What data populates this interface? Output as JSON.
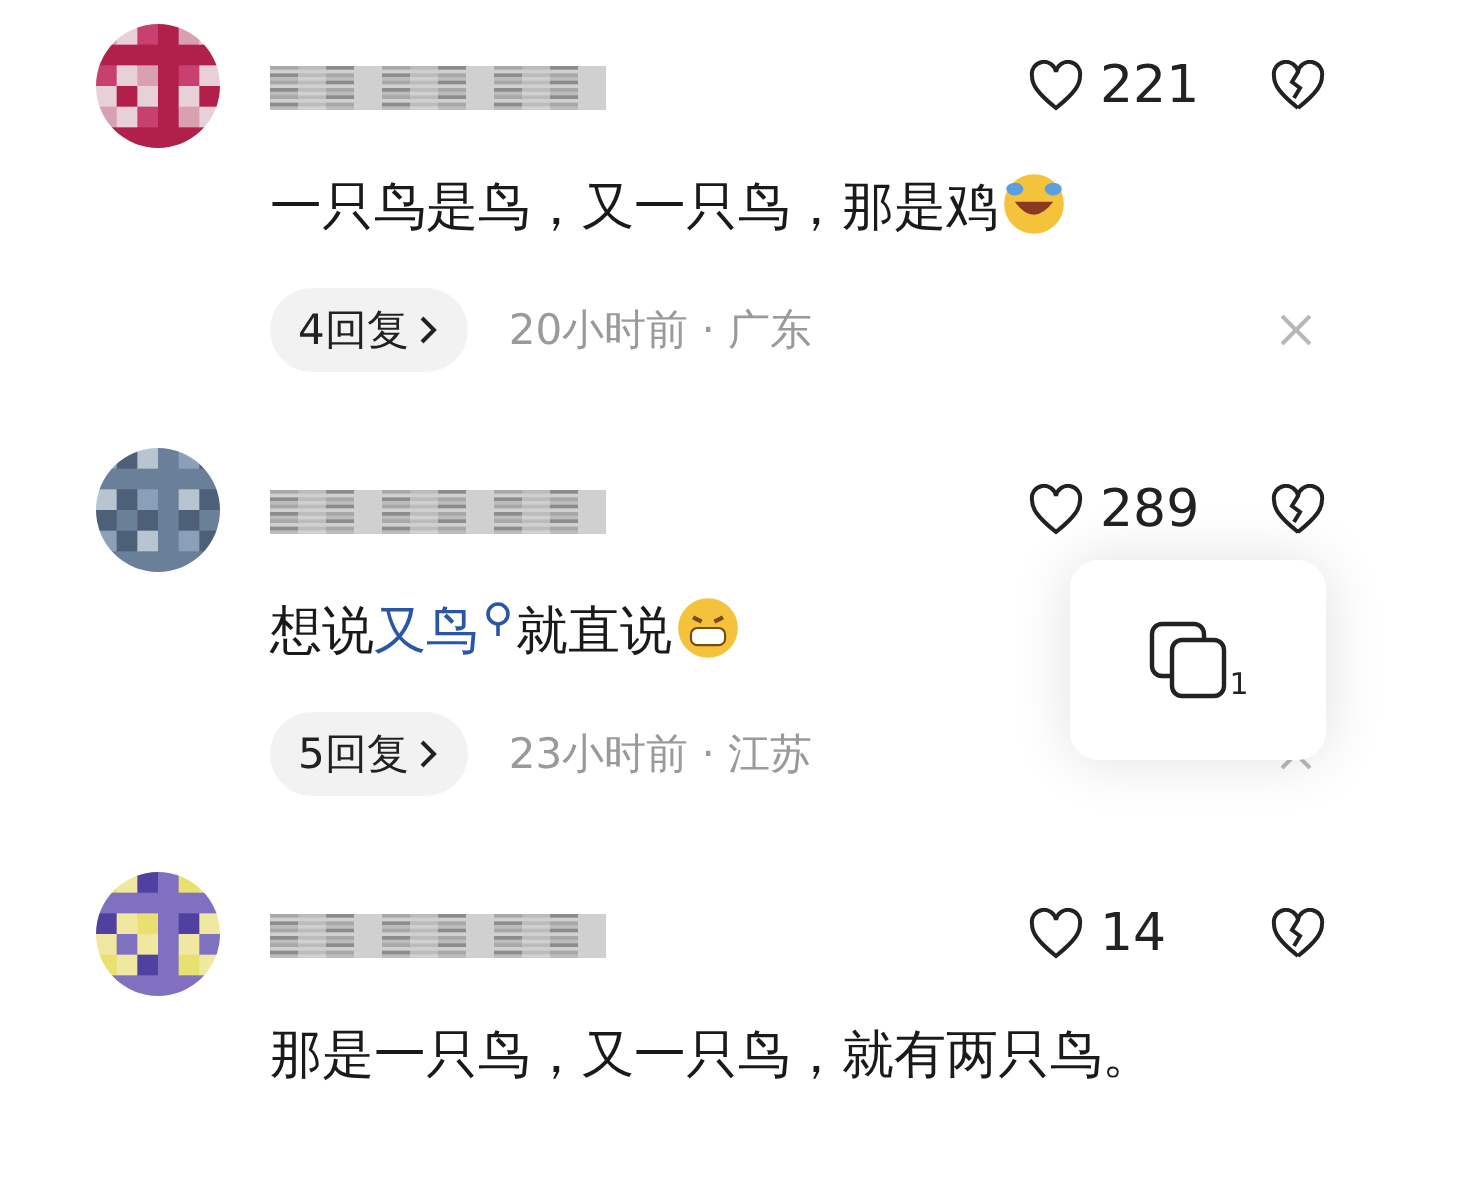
{
  "comments": [
    {
      "likes": "221",
      "text": [
        {
          "kind": "plain",
          "text": "一只鸟是鸟，又一只鸟，那是鸡"
        },
        {
          "kind": "laugh-emoji"
        }
      ],
      "replies": "4回复",
      "meta": "20小时前 · 广东"
    },
    {
      "likes": "289",
      "text": [
        {
          "kind": "plain",
          "text": "想说"
        },
        {
          "kind": "search-link",
          "text": "又鸟"
        },
        {
          "kind": "plain",
          "text": "就直说"
        },
        {
          "kind": "grin-emoji"
        }
      ],
      "replies": "5回复",
      "meta": "23小时前 · 江苏"
    },
    {
      "likes": "14",
      "text": [
        {
          "kind": "plain",
          "text": "那是一只鸟，又一只鸟，就有两只鸟。"
        }
      ]
    }
  ],
  "copy_card": {
    "count": "1"
  }
}
